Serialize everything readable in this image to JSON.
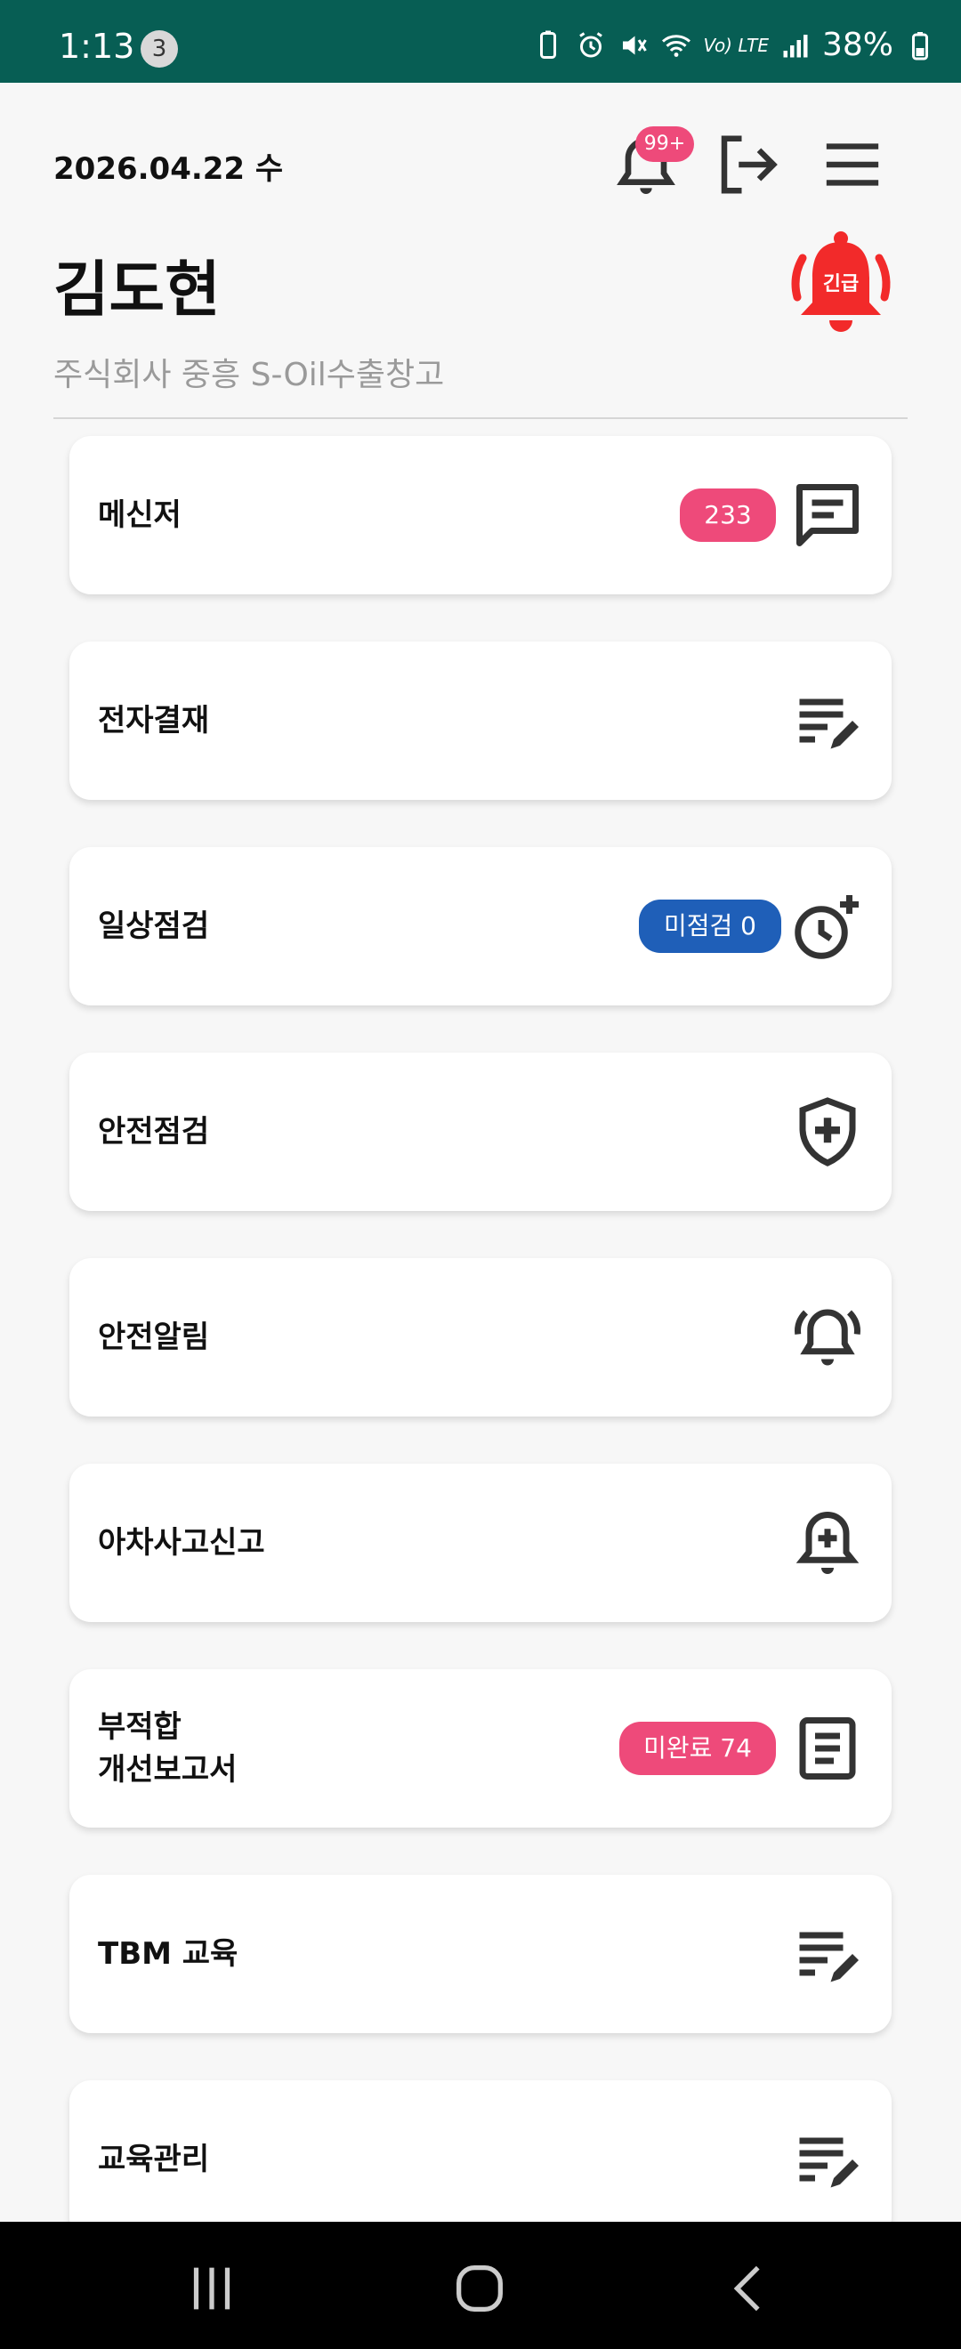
{
  "status_bar": {
    "time": "1:13",
    "notification_count": "3",
    "network": "Vo) LTE",
    "battery": "38%"
  },
  "header": {
    "date": "2026.04.22 수",
    "notification_badge": "99+",
    "user_name": "김도현",
    "company": "주식회사 중흥 S-Oil수출창고",
    "emergency_label": "긴급"
  },
  "menu": [
    {
      "label": "메신저",
      "badge": "233",
      "badge_color": "#ee4a7a",
      "icon": "chat-icon"
    },
    {
      "label": "전자결재",
      "badge": "",
      "icon": "edit-list-icon"
    },
    {
      "label": "일상점검",
      "badge": "미점검 0",
      "badge_color": "#1f5fb8",
      "icon": "clock-plus-icon"
    },
    {
      "label": "안전점검",
      "badge": "",
      "icon": "shield-plus-icon"
    },
    {
      "label": "안전알림",
      "badge": "",
      "icon": "bell-ring-icon"
    },
    {
      "label": "아차사고신고",
      "badge": "",
      "icon": "bell-plus-icon"
    },
    {
      "label_line1": "부적합",
      "label_line2": "개선보고서",
      "badge": "미완료 74",
      "badge_color": "#ee4a7a",
      "icon": "document-icon"
    },
    {
      "label": "TBM 교육",
      "badge": "",
      "icon": "edit-list-icon"
    },
    {
      "label": "교육관리",
      "badge": "",
      "icon": "edit-list-icon"
    }
  ],
  "colors": {
    "status_bar": "#075e54",
    "accent_pink": "#ee4a7a",
    "accent_blue": "#1f5fb8",
    "emergency_red": "#f22a2a"
  }
}
